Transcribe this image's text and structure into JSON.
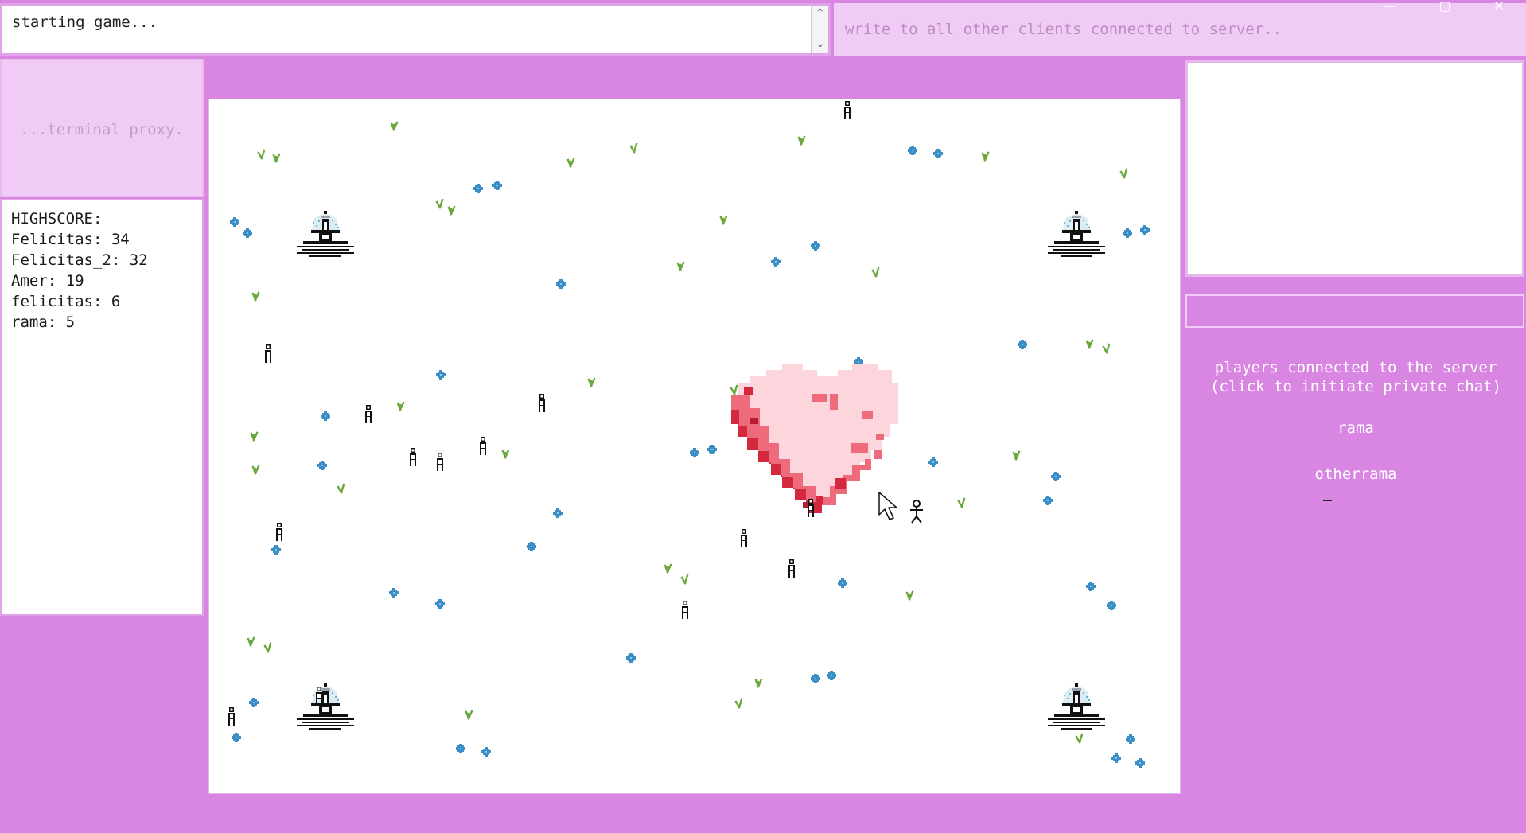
{
  "console": {
    "log_text": "starting game..."
  },
  "broadcast": {
    "placeholder": "write to all other clients connected to server.."
  },
  "window_controls": {
    "minimize": "—",
    "maximize": "▢",
    "close": "✕"
  },
  "terminal_proxy": {
    "placeholder": "...terminal proxy."
  },
  "highscore": {
    "title": "HIGHSCORE:",
    "entries": [
      {
        "name": "Felicitas",
        "score": 34,
        "line": "Felicitas: 34"
      },
      {
        "name": "Felicitas_2",
        "score": 32,
        "line": "Felicitas_2: 32"
      },
      {
        "name": "Amer",
        "score": 19,
        "line": "Amer: 19"
      },
      {
        "name": "felicitas",
        "score": 6,
        "line": "felicitas: 6"
      },
      {
        "name": "rama",
        "score": 5,
        "line": "rama: 5"
      }
    ]
  },
  "players_panel": {
    "heading_line1": "players connected to the server",
    "heading_line2": "(click to initiate private chat)",
    "players": [
      "rama",
      "otherrama"
    ]
  },
  "colors": {
    "frame": "#d986e2",
    "panel_light": "#f0cbf5",
    "grass": "#6aa83c",
    "flower": "#3b8fc6",
    "heart_light": "#fdd6dd",
    "heart_mid": "#ee6b7c",
    "heart_dark": "#d3283d"
  },
  "icons": {
    "scroll_up": "chevron-up-icon",
    "scroll_down": "chevron-down-icon",
    "cursor": "mouse-pointer-icon",
    "fountain": "fountain-icon",
    "npc": "person-icon",
    "heart": "heart-icon"
  }
}
